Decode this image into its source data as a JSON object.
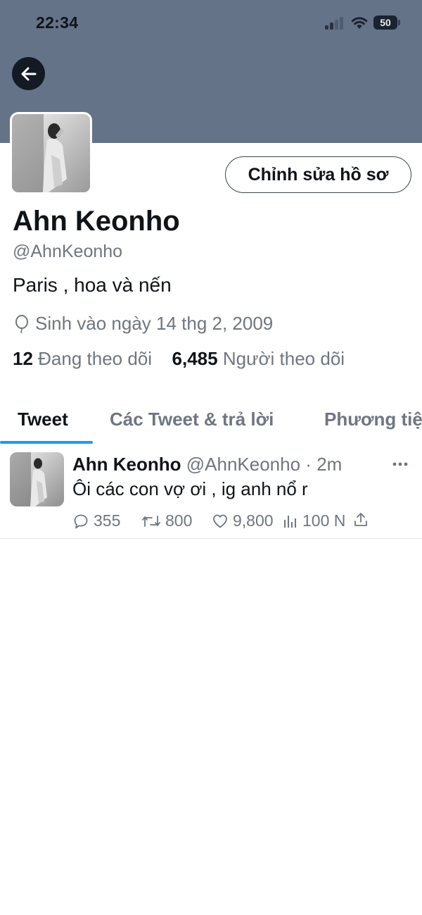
{
  "status_bar": {
    "time": "22:34",
    "battery": "50"
  },
  "profile": {
    "edit_button": "Chỉnh sửa hồ sơ",
    "display_name": "Ahn Keonho",
    "handle": "@AhnKeonho",
    "bio": "Paris , hoa và nến",
    "birth": "Sinh vào ngày 14 thg 2, 2009",
    "following_count": "12",
    "following_label": "Đang theo dõi",
    "followers_count": "6,485",
    "followers_label": "Người theo dõi"
  },
  "tabs": [
    {
      "label": "Tweet",
      "active": true
    },
    {
      "label": "Các Tweet & trả lời"
    },
    {
      "label": "Phương tiệ"
    }
  ],
  "tweet": {
    "name": "Ahn Keonho",
    "handle": "@AhnKeonho",
    "separator": "·",
    "time": "2m",
    "text": "Ôi các con vợ ơi , ig anh nổ r",
    "replies": "355",
    "retweets": "800",
    "likes": "9,800",
    "views": "100 N"
  },
  "colors": {
    "banner": "#657389",
    "accent": "#1d9bf0",
    "muted": "#6e7681"
  },
  "icons": [
    "back-arrow-icon",
    "signal-icon",
    "wifi-icon",
    "battery-icon",
    "balloon-icon",
    "more-icon",
    "reply-icon",
    "retweet-icon",
    "like-icon",
    "views-icon",
    "share-icon"
  ]
}
